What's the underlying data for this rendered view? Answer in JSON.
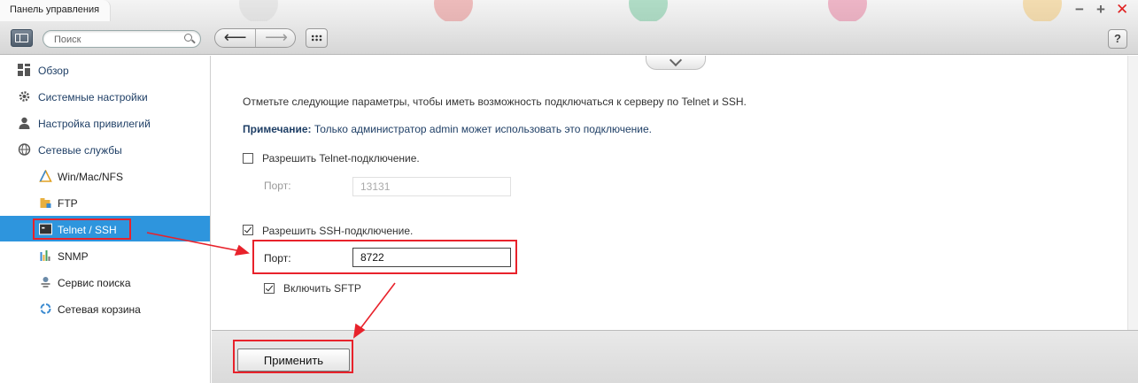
{
  "window": {
    "title": "Панель управления",
    "minimize": "−",
    "maximize": "+",
    "close": "✕"
  },
  "toolbar": {
    "search_placeholder": "Поиск",
    "back": "⟵",
    "forward": "⟶",
    "help": "?"
  },
  "sidebar": {
    "items": [
      {
        "label": "Обзор",
        "icon": "overview-icon"
      },
      {
        "label": "Системные настройки",
        "icon": "gear-icon"
      },
      {
        "label": "Настройка привилегий",
        "icon": "user-icon"
      },
      {
        "label": "Сетевые службы",
        "icon": "network-globe-icon"
      }
    ],
    "subitems": [
      {
        "label": "Win/Mac/NFS",
        "icon": "triangle-icon"
      },
      {
        "label": "FTP",
        "icon": "ftp-folder-icon"
      },
      {
        "label": "Telnet / SSH",
        "icon": "terminal-icon",
        "active": true
      },
      {
        "label": "SNMP",
        "icon": "bar-chart-icon"
      },
      {
        "label": "Сервис поиска",
        "icon": "search-service-icon"
      },
      {
        "label": "Сетевая корзина",
        "icon": "recycle-icon"
      }
    ]
  },
  "main": {
    "intro": "Отметьте следующие параметры, чтобы иметь возможность подключаться к серверу по Telnet и SSH.",
    "note_label": "Примечание:",
    "note_text": " Только администратор admin может использовать это подключение.",
    "telnet": {
      "label": "Разрешить Telnet-подключение.",
      "checked": false,
      "port_label": "Порт:",
      "port_value": "13131"
    },
    "ssh": {
      "label": "Разрешить SSH-подключение.",
      "checked": true,
      "port_label": "Порт:",
      "port_value": "8722"
    },
    "sftp": {
      "label": "Включить SFTP",
      "checked": true
    },
    "apply_label": "Применить"
  },
  "colors": {
    "accent": "#2e95dd",
    "annotation": "#e8222b",
    "nav_text": "#1f3f66"
  }
}
